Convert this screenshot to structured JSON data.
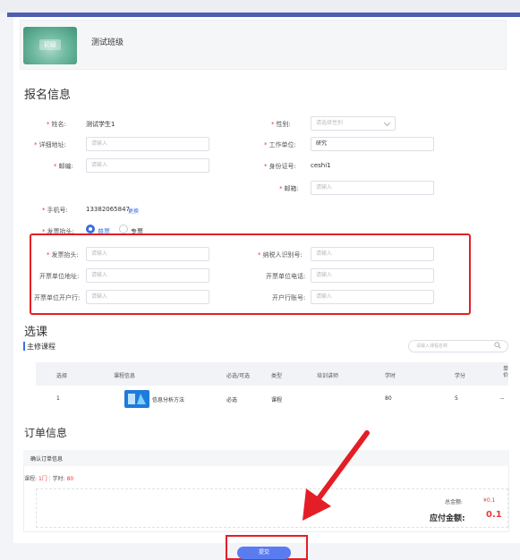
{
  "class": {
    "thumb_badge": "初级",
    "name": "测试班级"
  },
  "signup": {
    "title": "报名信息",
    "name_label": "姓名:",
    "name_value": "测试学生1",
    "gender_label": "性别:",
    "gender_placeholder": "请选择性别",
    "address_label": "详细地址:",
    "address_placeholder": "请输入",
    "workplace_label": "工作单位:",
    "workplace_value": "研究",
    "postcode_label": "邮编:",
    "postcode_placeholder": "请输入",
    "idcard_label": "身份证号:",
    "idcard_value": "ceshi1",
    "email_label": "邮箱:",
    "email_placeholder": "请输入",
    "phone_label": "手机号:",
    "phone_value": "13382065847",
    "phone_action": "更换",
    "invoice_type_label": "发票抬头:",
    "invoice_opt1": "普票",
    "invoice_opt2": "专票",
    "invoice_title_label": "发票抬头:",
    "invoice_title_placeholder": "请输入",
    "taxid_label": "纳税人识别号:",
    "taxid_placeholder": "请输入",
    "invoice_addr_label": "开票单位地址:",
    "invoice_addr_placeholder": "请输入",
    "invoice_phone_label": "开票单位电话:",
    "invoice_phone_placeholder": "请输入",
    "invoice_bank_label": "开票单位开户行:",
    "invoice_bank_placeholder": "请输入",
    "bank_account_label": "开户行账号:",
    "bank_account_placeholder": "请输入"
  },
  "course": {
    "title": "选课",
    "sub_title": "主修课程",
    "search_placeholder": "请输入课程名称",
    "columns": [
      "选择",
      "课程信息",
      "必选/可选",
      "类型",
      "培训讲师",
      "学时",
      "学分",
      "单价"
    ],
    "row": {
      "index": "1",
      "name": "信息分析方法",
      "required": "必选",
      "type": "课程",
      "teacher": "",
      "hours": "80",
      "credits": "5",
      "price": "--"
    }
  },
  "order": {
    "title": "订单信息",
    "confirm_label": "确认订单信息",
    "courses_label": "课程:",
    "courses_value": "1门",
    "hours_label": "学时:",
    "hours_value": "80",
    "total_label": "总金额:",
    "total_value": "¥0.1",
    "payable_label": "应付金额:",
    "payable_value": "0.1"
  },
  "footer": {
    "submit_label": "提交"
  },
  "colors": {
    "accent": "#3b6fe0",
    "highlight": "#e41e26",
    "submit": "#5b7cf0",
    "price": "#e83a3a"
  }
}
